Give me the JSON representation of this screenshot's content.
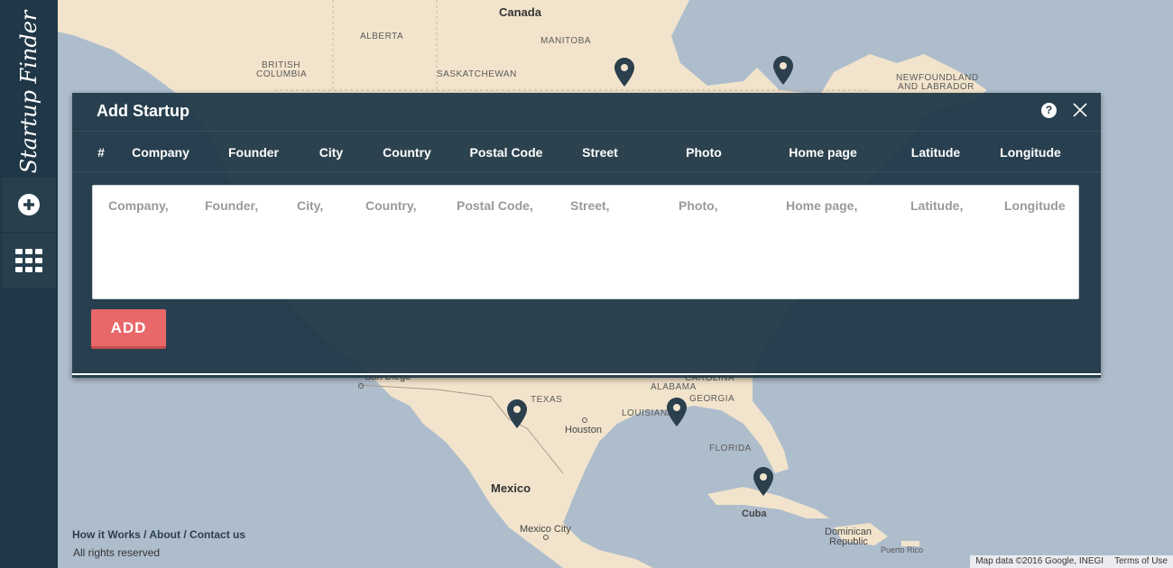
{
  "app": {
    "brand": "Startup Finder"
  },
  "sidebar": {
    "items": [
      {
        "name": "add-startup",
        "icon": "plus-circle-icon"
      },
      {
        "name": "list-view",
        "icon": "grid-icon"
      }
    ]
  },
  "map": {
    "labels": {
      "canada": "Canada",
      "alberta": "ALBERTA",
      "manitoba": "MANITOBA",
      "british_columbia_1": "BRITISH",
      "british_columbia_2": "COLUMBIA",
      "saskatchewan": "SASKATCHEWAN",
      "newfoundland_1": "NEWFOUNDLAND",
      "newfoundland_2": "AND LABRADOR",
      "texas": "TEXAS",
      "alabama": "ALABAMA",
      "georgia": "GEORGIA",
      "louisiana": "LOUISIANA",
      "houston": "Houston",
      "florida": "FLORIDA",
      "mexico": "Mexico",
      "mexico_city": "Mexico City",
      "cuba": "Cuba",
      "dominican_1": "Dominican",
      "dominican_2": "Republic",
      "puerto_rico": "Puerto Rico",
      "carolina": "CAROLINA",
      "san_diego": "San Diego"
    },
    "colors": {
      "land": "#f2e4cc",
      "water": "#aebdcc",
      "pin": "#2b3f4d"
    }
  },
  "dialog": {
    "title": "Add Startup",
    "help_label": "?",
    "columns": [
      "#",
      "Company",
      "Founder",
      "City",
      "Country",
      "Postal Code",
      "Street",
      "Photo",
      "Home page",
      "Latitude",
      "Longitude"
    ],
    "placeholders": [
      "Company,",
      "Founder,",
      "City,",
      "Country,",
      "Postal Code,",
      "Street,",
      "Photo,",
      "Home page,",
      "Latitude,",
      "Longitude"
    ],
    "add_label": "ADD"
  },
  "footer": {
    "links": [
      "How it Works",
      "About",
      "Contact us"
    ],
    "separator": " / ",
    "rights": "All rights reserved"
  },
  "attribution": {
    "map_data": "Map data ©2016 Google, INEGI",
    "terms": "Terms of Use"
  }
}
